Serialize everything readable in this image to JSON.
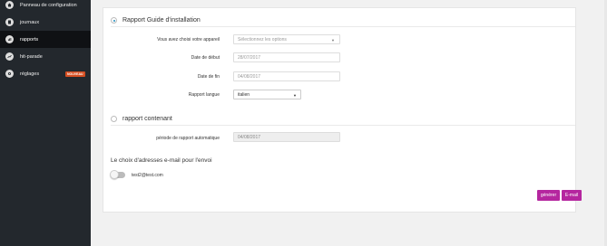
{
  "sidebar": {
    "items": [
      {
        "label": "Panneau de configuration",
        "icon": "home-icon"
      },
      {
        "label": "journaux",
        "icon": "document-icon"
      },
      {
        "label": "rapports",
        "icon": "report-icon",
        "active": true
      },
      {
        "label": "hit-parade",
        "icon": "trend-icon"
      },
      {
        "label": "réglages",
        "icon": "gear-icon",
        "badge": "NOUVEAU"
      }
    ]
  },
  "report_guide": {
    "title": "Rapport Guide d'installation",
    "device_label": "Vous avez choisi votre appareil",
    "device_placeholder": "Sélectionnez les options",
    "start_label": "Date de début",
    "start_value": "28/07/2017",
    "end_label": "Date de fin",
    "end_value": "04/08/2017",
    "language_label": "Rapport langue",
    "language_value": "italien"
  },
  "report_containing": {
    "title": "rapport contenant",
    "auto_period_label": "période de rapport automatique",
    "auto_period_value": "04/08/2017"
  },
  "email": {
    "title": "Le choix d'adresses e-mail pour l'envoi",
    "address": "test2@test.com"
  },
  "actions": {
    "generate": "générer",
    "email": "E-mail"
  },
  "colors": {
    "accent": "#b5269f",
    "sidebar": "#23282d",
    "badge": "#d54e21"
  }
}
